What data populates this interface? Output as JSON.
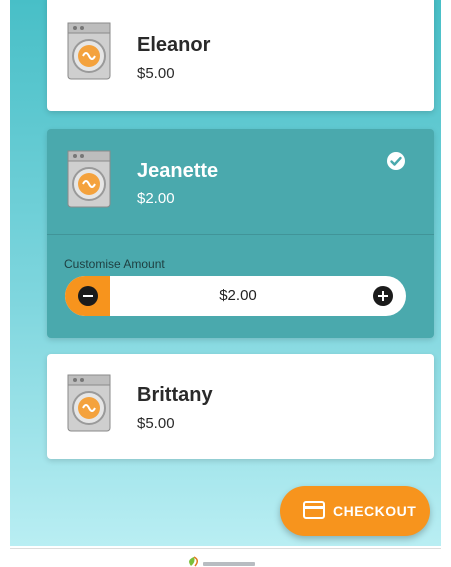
{
  "machines": [
    {
      "name": "Eleanor",
      "price": "$5.00",
      "selected": false
    },
    {
      "name": "Jeanette",
      "price": "$2.00",
      "selected": true
    },
    {
      "name": "Brittany",
      "price": "$5.00",
      "selected": false
    }
  ],
  "customise": {
    "label": "Customise Amount",
    "amount": "$2.00"
  },
  "checkout": {
    "label": "CHECKOUT"
  },
  "icons": {
    "machine": "washing-machine-icon",
    "selected": "check-circle-icon",
    "decrease": "minus-circle-icon",
    "increase": "plus-circle-icon",
    "checkout": "credit-card-icon",
    "footer": "leaf-logo-icon"
  },
  "colors": {
    "accent": "#f7941d",
    "selected_card": "#4aa9ad",
    "gradient_top": "#48bfc7",
    "gradient_bottom": "#b9eef3"
  }
}
